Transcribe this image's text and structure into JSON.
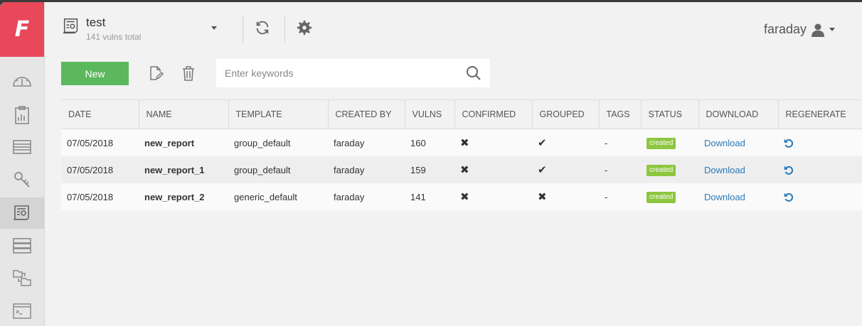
{
  "logo": {
    "letter": "F",
    "color": "#e8485a"
  },
  "sidebar": {
    "items": [
      {
        "icon": "dashboard-icon"
      },
      {
        "icon": "clipboard-icon"
      },
      {
        "icon": "list-icon"
      },
      {
        "icon": "keys-icon"
      },
      {
        "icon": "report-icon",
        "active": true
      },
      {
        "icon": "hosts-icon"
      },
      {
        "icon": "workspaces-icon"
      },
      {
        "icon": "terminal-icon"
      }
    ]
  },
  "header": {
    "workspace_name": "test",
    "workspace_vulns": "141 vulns total",
    "user_name": "faraday"
  },
  "toolbar": {
    "new_label": "New",
    "search_placeholder": "Enter keywords"
  },
  "table": {
    "columns": [
      "DATE",
      "NAME",
      "TEMPLATE",
      "CREATED BY",
      "VULNS",
      "CONFIRMED",
      "GROUPED",
      "TAGS",
      "STATUS",
      "DOWNLOAD",
      "REGENERATE"
    ],
    "rows": [
      {
        "date": "07/05/2018",
        "name": "new_report",
        "template": "group_default",
        "created_by": "faraday",
        "vulns": "160",
        "confirmed": "✖",
        "grouped": "✔",
        "tags": "-",
        "status": "created",
        "download": "Download"
      },
      {
        "date": "07/05/2018",
        "name": "new_report_1",
        "template": "group_default",
        "created_by": "faraday",
        "vulns": "159",
        "confirmed": "✖",
        "grouped": "✔",
        "tags": "-",
        "status": "created",
        "download": "Download"
      },
      {
        "date": "07/05/2018",
        "name": "new_report_2",
        "template": "generic_default",
        "created_by": "faraday",
        "vulns": "141",
        "confirmed": "✖",
        "grouped": "✖",
        "tags": "-",
        "status": "created",
        "download": "Download"
      }
    ]
  },
  "colors": {
    "accent_green": "#5cb85c",
    "status_green": "#8dc63f",
    "link_blue": "#2a7ab9"
  }
}
